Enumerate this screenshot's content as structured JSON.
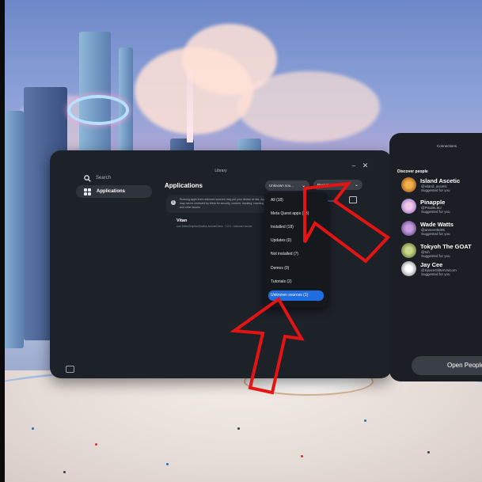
{
  "window": {
    "title": "Library",
    "minimize_icon": "minimize-icon",
    "close_icon": "close-icon"
  },
  "sidebar": {
    "search_label": "Search",
    "items": [
      {
        "label": "Applications",
        "icon": "grid-icon",
        "selected": true
      }
    ],
    "bottom_icon": "panel-toggle-icon"
  },
  "main": {
    "title": "Applications",
    "filter_value": "Unknown sou...",
    "sort_value": "Recent",
    "notice": {
      "text": "Running apps from unknown sources may put your device at risk. Apps may not be reviewed by Meta for security, content, tracking, crashing and other issues.",
      "link": "Learn More"
    },
    "apps": [
      {
        "name": "Vitan",
        "meta": "com.MetroGraphicsStudios.AutumnDemo · 1.0.0 · Unknown source"
      }
    ]
  },
  "filter_menu": {
    "options": [
      {
        "label": "All (18)",
        "selected": false
      },
      {
        "label": "Meta Quest apps (13)",
        "selected": false
      },
      {
        "label": "Installed (18)",
        "selected": false
      },
      {
        "label": "Updates (0)",
        "selected": false
      },
      {
        "label": "Not installed (7)",
        "selected": false
      },
      {
        "label": "Demos (0)",
        "selected": false
      },
      {
        "label": "Tutorials (2)",
        "selected": false
      },
      {
        "label": "Unknown sources (1)",
        "selected": true
      }
    ]
  },
  "people_panel": {
    "title": "Connections",
    "section": "Discover people",
    "people": [
      {
        "name": "Island Ascetic",
        "handle": "@island_ascetic",
        "note": "Suggested for you",
        "color": "#d9822b"
      },
      {
        "name": "Pinapple",
        "handle": "@PinaleLMJ",
        "note": "Suggested for you",
        "color": "#b58ad6"
      },
      {
        "name": "Wade Watts",
        "handle": "@anmerette95",
        "note": "Suggested for you",
        "color": "#8a6fb0"
      },
      {
        "name": "Tokyoh The GOAT",
        "handle": "@toh",
        "note": "Suggested for you",
        "color": "#7a9a4a"
      },
      {
        "name": "Jay Cee",
        "handle": "@SpaceGlitterUnicorn",
        "note": "Suggested for you",
        "color": "#d8d8d8"
      }
    ],
    "open_button": "Open People"
  },
  "colors": {
    "accent": "#1f6de0",
    "annotation": "#e51414",
    "window_bg": "#1d2128"
  }
}
